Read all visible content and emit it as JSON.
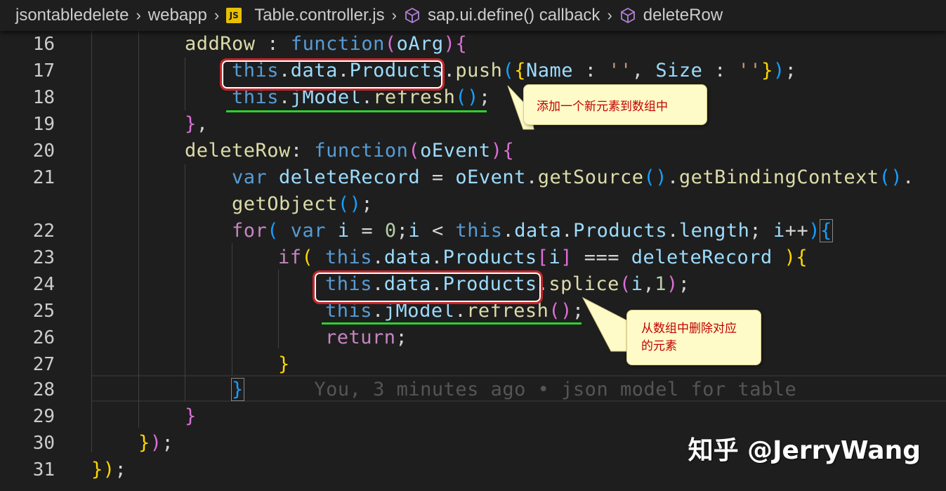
{
  "breadcrumb": {
    "items": [
      "jsontabledelete",
      "webapp",
      "Table.controller.js",
      "sap.ui.define() callback",
      "deleteRow"
    ],
    "js_badge": "JS",
    "separator": "›"
  },
  "editor": {
    "line_numbers": [
      "16",
      "17",
      "18",
      "19",
      "20",
      "21",
      "22",
      "23",
      "24",
      "25",
      "26",
      "27",
      "28",
      "29",
      "30",
      "31"
    ],
    "code": {
      "l16": [
        "addRow",
        " : ",
        "function",
        "(",
        "oArg",
        ")",
        "{"
      ],
      "l17": [
        "this",
        ".",
        "data",
        ".",
        "Products",
        ".",
        "push",
        "(",
        "{",
        "Name",
        " : ",
        "''",
        ", ",
        "Size",
        " : ",
        "''",
        "}",
        ")",
        ";"
      ],
      "l18": [
        "this",
        ".",
        "jModel",
        ".",
        "refresh",
        "()",
        ";"
      ],
      "l19": [
        "}",
        ","
      ],
      "l20": [
        "deleteRow",
        ": ",
        "function",
        "(",
        "oEvent",
        ")",
        "{"
      ],
      "l21": [
        "var",
        " ",
        "deleteRecord",
        " = ",
        "oEvent",
        ".",
        "getSource",
        "()",
        ".",
        "getBindingContext",
        "()",
        "."
      ],
      "l21b": [
        "getObject",
        "()",
        ";"
      ],
      "l22": [
        "for",
        "( ",
        "var",
        " ",
        "i",
        " = ",
        "0",
        ";",
        "i",
        " < ",
        "this",
        ".",
        "data",
        ".",
        "Products",
        ".",
        "length",
        "; ",
        "i",
        "++",
        ")",
        "{"
      ],
      "l23": [
        "if",
        "( ",
        "this",
        ".",
        "data",
        ".",
        "Products",
        "[",
        "i",
        "]",
        " === ",
        "deleteRecord",
        " )",
        "{"
      ],
      "l24": [
        "this",
        ".",
        "data",
        ".",
        "Products",
        ".",
        "splice",
        "(",
        "i",
        ",",
        "1",
        ")",
        ";"
      ],
      "l25": [
        "this",
        ".",
        "jModel",
        ".",
        "refresh",
        "()",
        ";"
      ],
      "l26": [
        "return",
        ";"
      ],
      "l27": [
        "}"
      ],
      "l28": [
        "}",
        "You, 3 minutes ago • json model for table"
      ],
      "l29": [
        "}"
      ],
      "l30": [
        "}",
        ")",
        ";"
      ],
      "l31": [
        "}",
        ")",
        ";"
      ]
    }
  },
  "callouts": {
    "add": "添加一个新元素到数组中",
    "delete": "从数组中删除对应的元素"
  },
  "watermark": "知乎 @JerryWang",
  "colors": {
    "red_box": "#c8252a",
    "green_underline": "#2ed12e",
    "callout_bg": "#fffbc8",
    "callout_text": "#c00000"
  },
  "icons": [
    "chevron-right-icon",
    "js-file-icon",
    "method-cube-icon"
  ]
}
